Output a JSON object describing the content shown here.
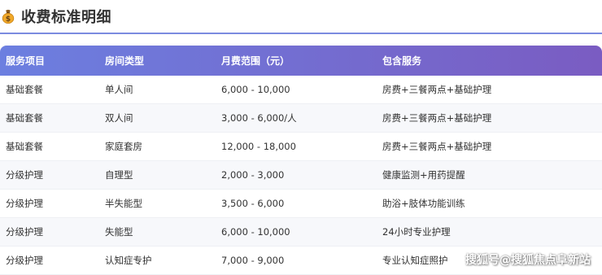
{
  "section": {
    "title": "收费标准明细",
    "icon": "money-bag-icon"
  },
  "table": {
    "headers": [
      "服务项目",
      "房间类型",
      "月费范围（元）",
      "包含服务"
    ],
    "rows": [
      [
        "基础套餐",
        "单人间",
        "6,000 - 10,000",
        "房费+三餐两点+基础护理"
      ],
      [
        "基础套餐",
        "双人间",
        "3,000 - 6,000/人",
        "房费+三餐两点+基础护理"
      ],
      [
        "基础套餐",
        "家庭套房",
        "12,000 - 18,000",
        "房费+三餐两点+基础护理"
      ],
      [
        "分级护理",
        "自理型",
        "2,000 - 3,000",
        "健康监测+用药提醒"
      ],
      [
        "分级护理",
        "半失能型",
        "3,500 - 6,000",
        "助浴+肢体功能训练"
      ],
      [
        "分级护理",
        "失能型",
        "6,000 - 10,000",
        "24小时专业护理"
      ],
      [
        "分级护理",
        "认知症专护",
        "7,000 - 9,000",
        "专业认知症照护"
      ]
    ]
  },
  "watermark": "搜狐号@搜狐焦点阜新站",
  "colors": {
    "header_start": "#6c7fe0",
    "header_end": "#7a5cc2",
    "rule": "#7b8be0"
  }
}
